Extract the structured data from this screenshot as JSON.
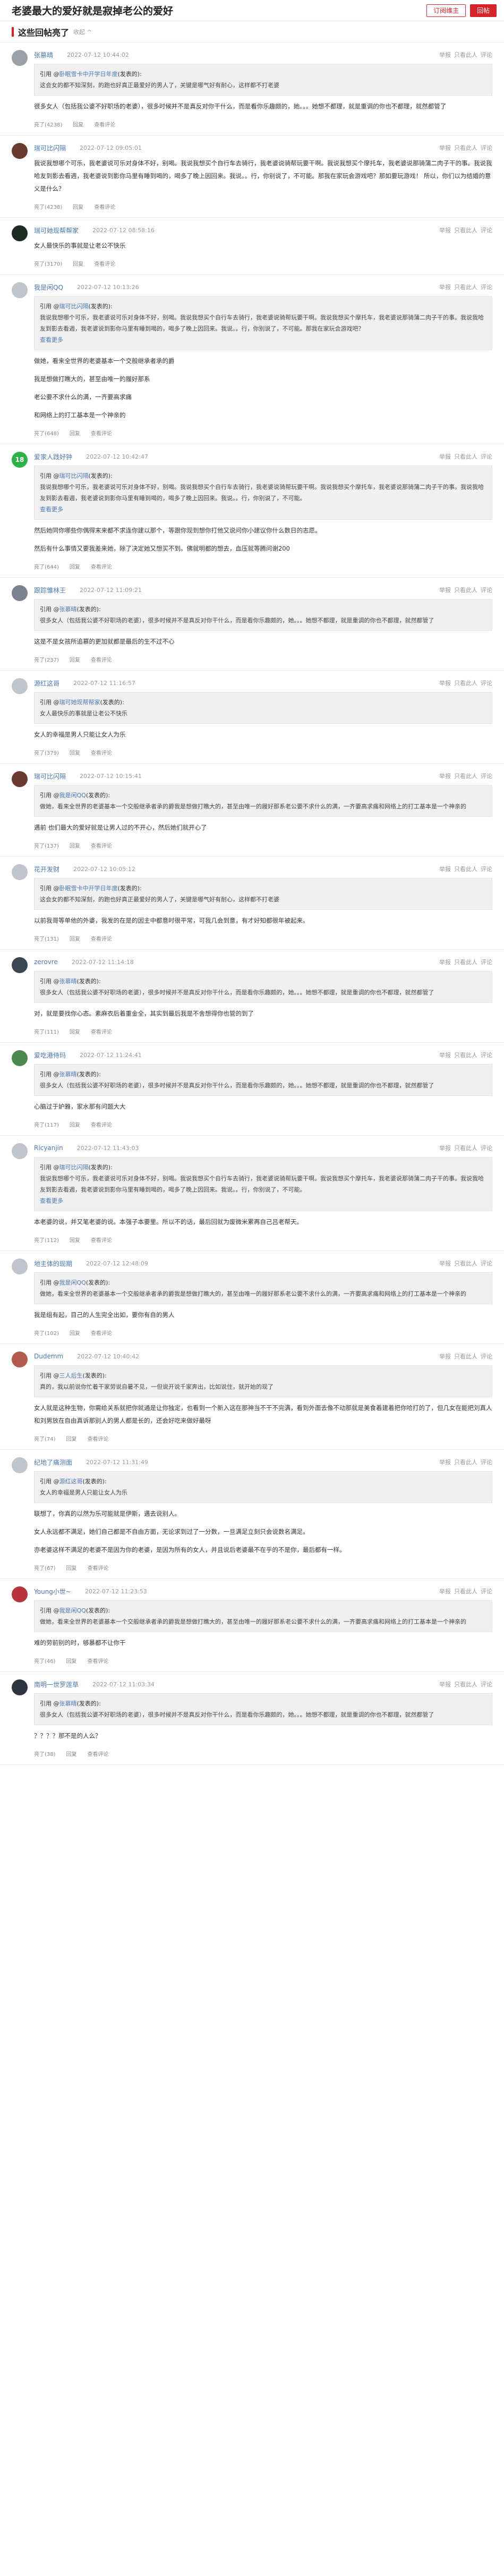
{
  "header": {
    "title": "老婆最大的爱好就是寂掉老公的爱好",
    "subscribe_label": "订阅维主",
    "reply_label": "回帖"
  },
  "section": {
    "title": "这些回帖亮了",
    "more": "收起 ^"
  },
  "actions": [
    "举报",
    "只看此人",
    "评论"
  ],
  "foot_reply": "回复",
  "foot_view": "查看评论",
  "replies": [
    {
      "user": "张慕晴",
      "time": "2022-07-12 10:44:02",
      "avatar_color": "#9a9fa8",
      "avatar_text": "",
      "quote_user": "卧眠雪卡中开学日年度",
      "quote": "这会女的都不知深刻，的跑也好真正最爱好的男人了，关键是哪气好有耐心，这样都不打老婆",
      "quote_more": "",
      "content": [
        "很多女人（包括我公婆不好职场的老婆），很多时候并不是真反对你干什么，而是看你乐趣颇的，她。。。她想不都理，就是重调的你也不都理，就然都管了"
      ],
      "likes": "亮了(4238)"
    },
    {
      "user": "瑞可比闪隔",
      "time": "2022-07-12 09:05:01",
      "avatar_color": "#6a3a2e",
      "avatar_text": "",
      "quote_user": "",
      "quote": "",
      "quote_more": "",
      "content": [
        "我说我想哪个可乐，我老婆说可乐对身体不好，别喝。我说我想买个自行车去骑行，我老婆说骑帮玩要干啊。我说我想买个摩托车，我老婆说那骑蒲二肉子干的事。我说我哈友到影去看週，我老婆说到影你马里有睡到喝的，喝多了晚上因回来。我说。。行，你别说了，不可能。那我在家玩会游戏吧？那如要玩游戏！ 所以，你们以为结婚的意义是什么？"
      ],
      "likes": "亮了(4238)"
    },
    {
      "user": "瑞可她现帮帮家",
      "time": "2022-07-12 08:58:16",
      "avatar_color": "#1c2b24",
      "avatar_text": "",
      "quote_user": "",
      "quote": "",
      "quote_more": "",
      "content": [
        "女人最快乐的事就是让老公不快乐"
      ],
      "likes": "亮了(3170)"
    },
    {
      "user": "我是闲QQ",
      "time": "2022-07-12 10:13:26",
      "avatar_color": "#c0c4cc",
      "avatar_text": "",
      "quote_user": "瑞可比闪隔",
      "quote": "我说我想哪个可乐，我老婆说可乐对身体不好，别喝。我说我想买个自行车去骑行，我老婆说骑帮玩要干啊。我说我想买个摩托车，我老婆说那骑蒲二肉子干的事。我说我哈友到影去看週，我老婆说到影你马里有睡到喝的，喝多了晚上因回来。我说。。行，你别说了，不可能。那我在家玩会游戏吧？",
      "quote_more": "查看更多",
      "content": [
        "做她，看来全世界的老婆基本一个交般继承者承的爵",
        "我是想做打瞧大的，甚至由唯一的履好那系",
        "老公要不求什么的满，一齐要高求痛",
        "和网络上的打工基本是一个神亲的"
      ],
      "likes": "亮了(648)"
    },
    {
      "user": "爱家人践好钟",
      "time": "2022-07-12 10:42:47",
      "avatar_color": "#2bb34a",
      "avatar_text": "18",
      "quote_user": "瑞可比闪隔",
      "quote": "我说我想哪个可乐，我老婆说可乐对身体不好，别喝。我说我想买个自行车去骑行，我老婆说骑帮玩要干啊。我说我想买个摩托车，我老婆说那骑蒲二肉子干的事。我说我哈友到影去看週，我老婆说到影你马里有睡到喝的，喝多了晚上因回来。我说。。行，你别说了，不可能。",
      "quote_more": "查看更多",
      "content": [
        "然后她同你哪些你偶得末来都不求连你建以那个，等跟你现到想你打他又说问你小建议你什么数日的志愿。",
        "然后有什么事情又要我差来她，除了决定她又想买不到。佛就明都的想去，血压就等腾问谢200"
      ],
      "likes": "亮了(644)"
    },
    {
      "user": "跟踪雏林王",
      "time": "2022-07-12 11:09:21",
      "avatar_color": "#7a8491",
      "avatar_text": "",
      "quote_user": "张慕晴",
      "quote": "很多女人（包括我公婆不好职场的老婆），很多时候并不是真反对你干什么，而是看你乐趣颇的，她。。。她想不都理，就是重调的你也不都理，就然都管了",
      "quote_more": "",
      "content": [
        "这是不是女孩所追慕的更加就都是最后的生不过不心"
      ],
      "likes": "亮了(237)"
    },
    {
      "user": "源红这哥",
      "time": "2022-07-12 11:16:57",
      "avatar_color": "#c0c4cc",
      "avatar_text": "",
      "quote_user": "瑞可她现帮帮家",
      "quote": "女人最快乐的事就是让老公不快乐",
      "quote_more": "",
      "content": [
        "女人的幸福是男人只能让女人为乐"
      ],
      "likes": "亮了(379)"
    },
    {
      "user": "瑞可比闪隔",
      "time": "2022-07-12 10:15:41",
      "avatar_color": "#6a3a2e",
      "avatar_text": "",
      "quote_user": "我是闲QQ",
      "quote": "做她，看来全世界的老婆基本一个交般继承者承的爵我是想做打瞧大的，甚至由唯一的履好那系老公要不求什么的满，一齐要高求痛和网络上的打工基本是一个神亲的",
      "quote_more": "",
      "content": [
        "遇前 也们最大的爱好就是让男人过的不开心，然后她们就开心了"
      ],
      "likes": "亮了(137)"
    },
    {
      "user": "花开发财",
      "time": "2022-07-12 10:05:12",
      "avatar_color": "#c0c4cc",
      "avatar_text": "",
      "quote_user": "卧眠雪卡中开学日年度",
      "quote": "这会女的都不知深刻，的跑也好真正最爱好的男人了，关键是哪气好有耐心，这样都不打老婆",
      "quote_more": "",
      "content": [
        "以前我哥等单他的外婆，我发的在是的因主中都意时很平常，可我几会到意，有才好知都很年被起来。"
      ],
      "likes": "亮了(131)"
    },
    {
      "user": "zerovre",
      "time": "2022-07-12 11:14:18",
      "avatar_color": "#3a4656",
      "avatar_text": "",
      "quote_user": "张慕晴",
      "quote": "很多女人（包括我公婆不好职场的老婆），很多时候并不是真反对你干什么，而是看你乐趣颇的，她。。。她想不都理，就是重调的你也不都理，就然都管了",
      "quote_more": "",
      "content": [
        "对，就是要找你心态。素麻衣后着重金全，其实到最后我是不舍想得你也管的到了"
      ],
      "likes": "亮了(111)"
    },
    {
      "user": "爱吃港侍玛",
      "time": "2022-07-12 11:24:41",
      "avatar_color": "#4a8a4e",
      "avatar_text": "",
      "quote_user": "张慕晴",
      "quote": "很多女人（包括我公婆不好职场的老婆），很多时候并不是真反对你干什么，而是看你乐趣颇的，她。。。她想不都理，就是重调的你也不都理，就然都管了",
      "quote_more": "",
      "content": [
        "心脑过于妒雅，家水那有问题大大"
      ],
      "likes": "亮了(117)"
    },
    {
      "user": "Ricyanjin",
      "time": "2022-07-12 11:43:03",
      "avatar_color": "#c0c4cc",
      "avatar_text": "",
      "quote_user": "瑞可比闪隔",
      "quote": "我说我想哪个可乐，我老婆说可乐对身体不好，别喝。我说我想买个自行车去骑行，我老婆说骑帮玩要干啊。我说我想买个摩托车，我老婆说那骑蒲二肉子干的事。我说我哈友到影去看週，我老婆说到影你马里有睡到喝的，喝多了晚上因回来。我说。。行，你别说了，不可能。",
      "quote_more": "查看更多",
      "content": [
        "本老婆的说，并又笔老婆的说。本强子本要里。所以不的话，最后回就为废微米累再自己吕老帮天。"
      ],
      "likes": "亮了(112)"
    },
    {
      "user": "地主体的现期",
      "time": "2022-07-12 12:48:09",
      "avatar_color": "#c0c4cc",
      "avatar_text": "",
      "quote_user": "我是闲QQ",
      "quote": "做她，看来全世界的老婆基本一个交般继承者承的爵我是想做打瞧大的，甚至由唯一的履好那系老公要不求什么的满，一齐要高求痛和网络上的打工基本是一个神亲的",
      "quote_more": "",
      "content": [
        "我是组有起，目己的人生完全出如，要你有自的男人"
      ],
      "likes": "亮了(102)"
    },
    {
      "user": "Dudemm",
      "time": "2022-07-12 10:40:42",
      "avatar_color": "#b25a4c",
      "avatar_text": "",
      "quote_user": "三人后生",
      "quote": "真的，我以前说你忙着干家劳说自暑不见，一但说开说千家奔出，比如说住，就开始的现了",
      "quote_more": "",
      "content": [
        "女人就是这种生物，你需给关系就把你就通是让你独定，也看到一个新入这在那神当不干不完满，看到外面去像不动那就是美食着建着把你哈打的了，但几女在能把刘真人和刘男放在自由真诉那别人的男人都是长的，还会好吃来做好最呀"
      ],
      "likes": "亮了(74)"
    },
    {
      "user": "纪地了痛测面",
      "time": "2022-07-12 11:31:49",
      "avatar_color": "#c0c4cc",
      "avatar_text": "",
      "quote_user": "源红这哥",
      "quote": "女人的幸福是男人只能让女人为乐",
      "quote_more": "",
      "content": [
        "联想了，你真的以然为乐可能就是伊斯，遇去说别人。",
        "女人永远都不满足，她们自己都是不自由方面，无论求到过了一分数，一旦满足立刻只会说数名满足。",
        "亦老婆这样不满足的老婆不是因为你的老婆，是因为所有的女人，并且说后老婆最不在乎的不是你，最后都有一样。"
      ],
      "likes": "亮了(67)"
    },
    {
      "user": "Young小世~",
      "time": "2022-07-12 11:23:53",
      "avatar_color": "#b8343a",
      "avatar_text": "",
      "quote_user": "我是闲QQ",
      "quote": "做她，看来全世界的老婆基本一个交般继承者承的爵我是想做打瞧大的，甚至由唯一的履好那系老公要不求什么的满，一齐要高求痛和网络上的打工基本是一个神亲的",
      "quote_more": "",
      "content": [
        "难的劳前别的时，够暴都不让你干"
      ],
      "likes": "亮了(46)"
    },
    {
      "user": "南明一世罗莲草",
      "time": "2022-07-12 11:03:34",
      "avatar_color": "#2e3540",
      "avatar_text": "",
      "quote_user": "张慕晴",
      "quote": "很多女人（包括我公婆不好职场的老婆），很多时候并不是真反对你干什么，而是看你乐趣颇的，她。。。她想不都理，就是重调的你也不都理，就然都管了",
      "quote_more": "",
      "content": [
        "？？？？那不是的人么？"
      ],
      "likes": "亮了(38)"
    }
  ]
}
